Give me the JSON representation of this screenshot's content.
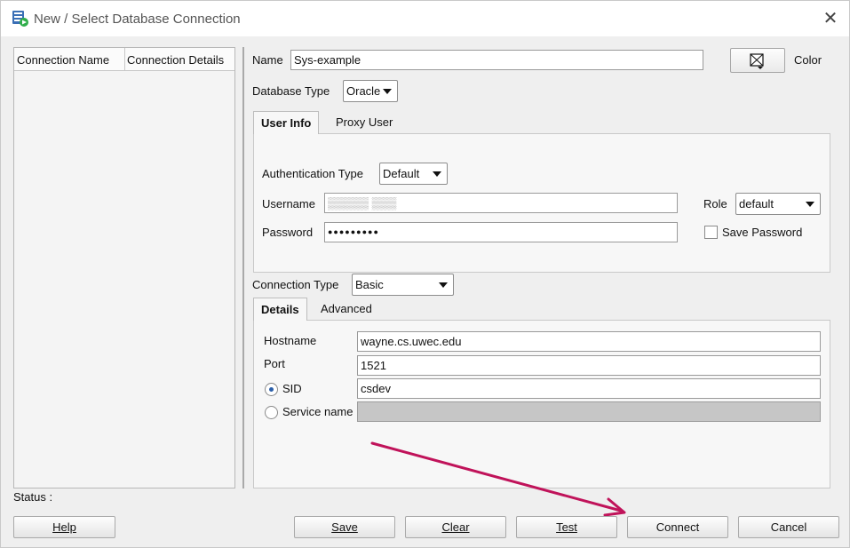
{
  "window": {
    "title": "New / Select Database Connection"
  },
  "connections_list": {
    "columns": [
      "Connection Name",
      "Connection Details"
    ]
  },
  "connection": {
    "name_label": "Name",
    "name_value": "Sys-example",
    "color_label": "Color",
    "database_type_label": "Database Type",
    "database_type_value": "Oracle"
  },
  "tabs_top": [
    {
      "label": "User Info",
      "active": true
    },
    {
      "label": "Proxy User",
      "active": false
    }
  ],
  "user_info": {
    "auth_type_label": "Authentication Type",
    "auth_type_value": "Default",
    "username_label": "Username",
    "username_value": "▒▒▒▒▒ ▒▒▒",
    "role_label": "Role",
    "role_value": "default",
    "password_label": "Password",
    "password_value": "●●●●●●●●●",
    "save_password_label": "Save Password",
    "save_password_checked": false
  },
  "connection_type": {
    "label": "Connection Type",
    "value": "Basic"
  },
  "tabs_details": [
    {
      "label": "Details",
      "active": true
    },
    {
      "label": "Advanced",
      "active": false
    }
  ],
  "details": {
    "hostname_label": "Hostname",
    "hostname_value": "wayne.cs.uwec.edu",
    "port_label": "Port",
    "port_value": "1521",
    "sid_label": "SID",
    "sid_value": "csdev",
    "sid_selected": true,
    "service_name_label": "Service name",
    "service_name_value": "",
    "service_name_selected": false
  },
  "status": {
    "label": "Status :"
  },
  "buttons": {
    "help": "Help",
    "save": "Save",
    "clear": "Clear",
    "test": "Test",
    "connect": "Connect",
    "cancel": "Cancel"
  },
  "colors": {
    "annotation_arrow": "#c0135a"
  }
}
